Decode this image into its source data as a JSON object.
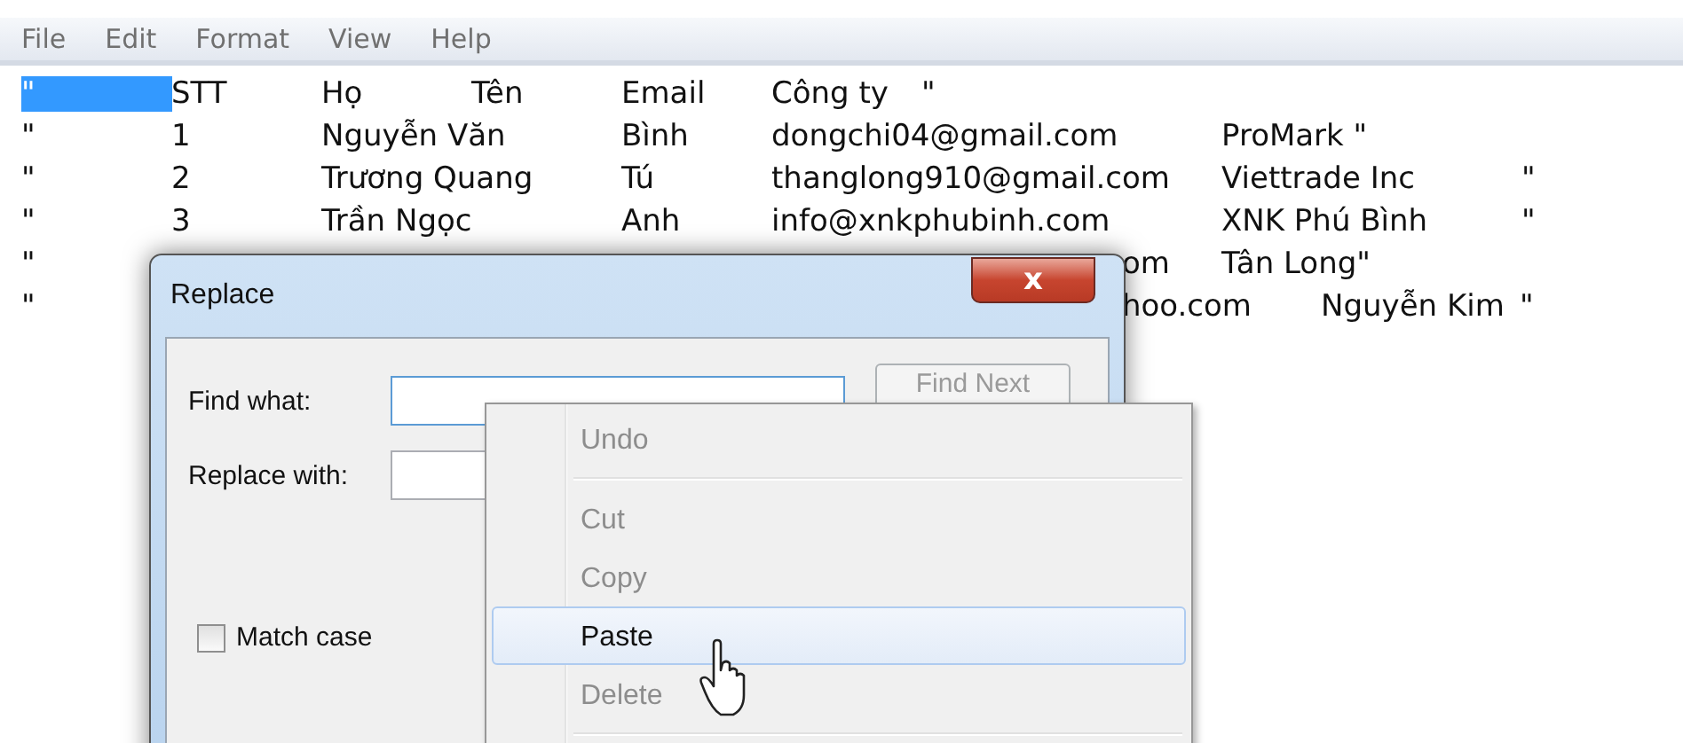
{
  "menu_bar": [
    "File",
    "Edit",
    "Format",
    "View",
    "Help"
  ],
  "lines": [
    {
      "kind": "full",
      "selected_part": "\"\t",
      "text": "STT\tHọ\tTên\tEmail\tCông ty\t\""
    },
    {
      "kind": "full",
      "text": "\"\t1\tNguyễn Văn\tBình\tdongchi04@gmail.com\tProMark \""
    },
    {
      "kind": "full",
      "text": "\"\t2\tTrương Quang\tTú\tthanglong910@gmail.com\tViettrade Inc\t\""
    },
    {
      "kind": "full",
      "text": "\"\t3\tTrần Ngọc\tAnh\tinfo@xnkphubinh.com\tXNK Phú Bình\t\""
    },
    {
      "kind": "covered",
      "start": "\"",
      "tail": "om\tTân Long\""
    },
    {
      "kind": "covered",
      "start": "\"",
      "tail": "hoo.com\tNguyễn Kim\t\""
    }
  ],
  "dialog": {
    "title": "Replace",
    "close": "x",
    "find_label": "Find what:",
    "replace_label": "Replace with:",
    "find_next": "Find Next",
    "match_case": {
      "label": "Match case",
      "checked": false
    }
  },
  "context_menu": [
    {
      "kind": "item",
      "label": "Undo",
      "disabled": true,
      "selected": false
    },
    {
      "kind": "separator"
    },
    {
      "kind": "item",
      "label": "Cut",
      "disabled": true,
      "selected": false
    },
    {
      "kind": "item",
      "label": "Copy",
      "disabled": true,
      "selected": false
    },
    {
      "kind": "item",
      "label": "Paste",
      "disabled": false,
      "selected": true
    },
    {
      "kind": "item",
      "label": "Delete",
      "disabled": true,
      "selected": false
    },
    {
      "kind": "separator"
    }
  ]
}
